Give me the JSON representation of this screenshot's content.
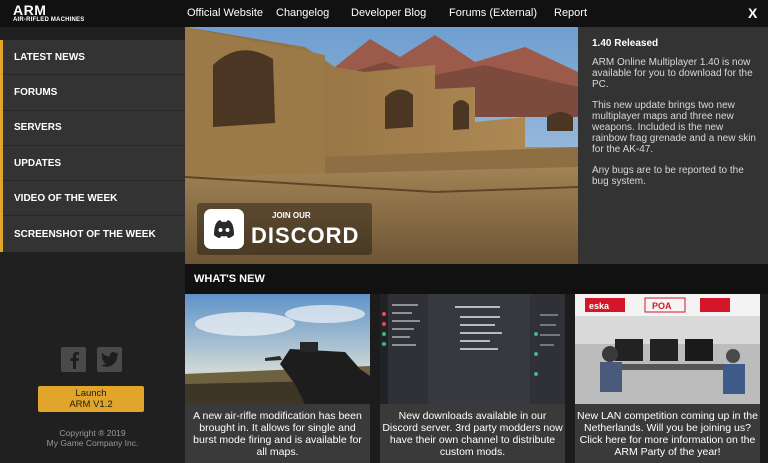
{
  "app": {
    "logo_main": "ARM",
    "logo_sub": "AIR-RIFLED MACHINES",
    "close_label": "X"
  },
  "nav": {
    "items": [
      {
        "label": "Official Website"
      },
      {
        "label": "Changelog"
      },
      {
        "label": "Developer Blog"
      },
      {
        "label": "Forums (External)"
      },
      {
        "label": "Report"
      }
    ]
  },
  "sidebar": {
    "items": [
      {
        "label": "LATEST NEWS"
      },
      {
        "label": "FORUMS"
      },
      {
        "label": "SERVERS"
      },
      {
        "label": "UPDATES"
      },
      {
        "label": "VIDEO OF THE WEEK"
      },
      {
        "label": "SCREENSHOT OF THE WEEK"
      }
    ],
    "social": [
      {
        "icon": "facebook-icon"
      },
      {
        "icon": "twitter-icon"
      }
    ],
    "launch_line1": "Launch",
    "launch_line2": "ARM V1.2",
    "copyright_line1": "Copyright ® 2019",
    "copyright_line2": "My Game Company Inc.",
    "accent_color": "#e0a52a"
  },
  "hero": {
    "discord_join": "JOIN OUR",
    "discord_word": "DISCORD"
  },
  "article": {
    "title": "1.40 Released",
    "paragraphs": [
      "ARM Online Multiplayer 1.40 is now available for you to download for the PC.",
      "This new update brings two new multiplayer maps and three new weapons. Included is the new rainbow frag grenade and a new skin for the AK-47.",
      "Any bugs are to be reported to the bug system."
    ]
  },
  "whats_new": {
    "title": "WHAT'S NEW",
    "cards": [
      {
        "caption": "A new air-rifle modification has been brought in. It allows for single and burst mode firing and is available for all maps."
      },
      {
        "caption": "New downloads available in our Discord server. 3rd party modders now have their own channel to distribute custom mods."
      },
      {
        "caption": "New LAN competition coming up in the Netherlands. Will you be joining us? Click here for more information on the ARM Party of the year!"
      }
    ],
    "banner_labels": [
      "eska",
      "POA"
    ]
  }
}
